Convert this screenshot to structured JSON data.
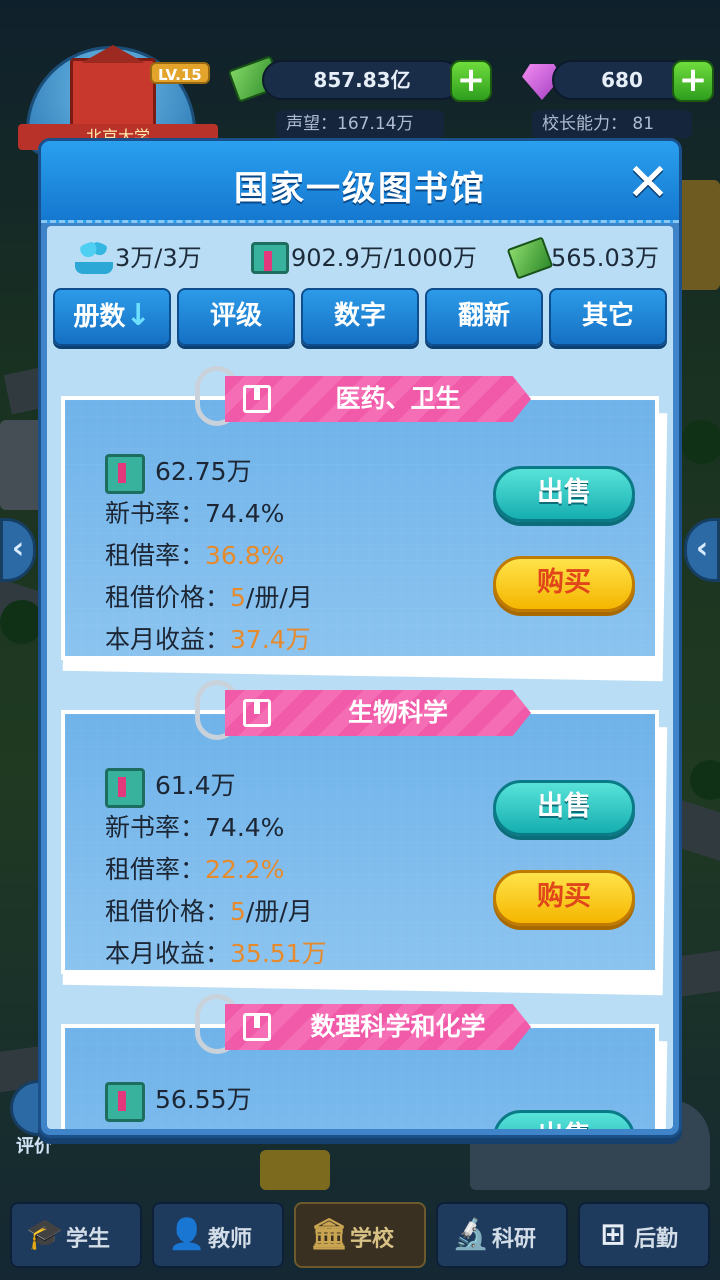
{
  "topbar": {
    "school_name": "北京大学",
    "level": "LV.15",
    "money": "857.83亿",
    "gems": "680",
    "reputation": "声望：167.14万",
    "principal_ability": "校长能力：  81"
  },
  "modal": {
    "title": "国家一级图书馆",
    "stats": {
      "capacity": "3万/3万",
      "books": "902.9万/1000万",
      "funds": "565.03万"
    },
    "tabs": [
      {
        "label": "册数",
        "sort_icon": "↓"
      },
      {
        "label": "评级"
      },
      {
        "label": "数字"
      },
      {
        "label": "翻新"
      },
      {
        "label": "其它"
      }
    ],
    "categories": [
      {
        "name": "医药、卫生",
        "count": "62.75万",
        "new_rate_label": "新书率：",
        "new_rate": "74.4%",
        "borrow_rate_label": "租借率：",
        "borrow_rate": "36.8%",
        "price_label": "租借价格：",
        "price": "5",
        "price_unit": "/册/月",
        "income_label": "本月收益：",
        "income": "37.4万",
        "sell_label": "出售",
        "buy_label": "购买"
      },
      {
        "name": "生物科学",
        "count": "61.4万",
        "new_rate_label": "新书率：",
        "new_rate": "74.4%",
        "borrow_rate_label": "租借率：",
        "borrow_rate": "22.2%",
        "price_label": "租借价格：",
        "price": "5",
        "price_unit": "/册/月",
        "income_label": "本月收益：",
        "income": "35.51万",
        "sell_label": "出售",
        "buy_label": "购买"
      },
      {
        "name": "数理科学和化学",
        "count": "56.55万",
        "sell_label": "出售"
      }
    ]
  },
  "side_badge": "评价",
  "bottom_nav": [
    {
      "label": "学生",
      "icon": "graduation-cap-icon",
      "active": false
    },
    {
      "label": "教师",
      "icon": "teacher-icon",
      "active": false
    },
    {
      "label": "学校",
      "icon": "school-icon",
      "active": true
    },
    {
      "label": "科研",
      "icon": "microscope-icon",
      "active": false
    },
    {
      "label": "后勤",
      "icon": "logistics-icon",
      "active": false
    }
  ],
  "colors": {
    "highlight": "#e68a2e",
    "banner": "#f05aa8",
    "sell_button": "#16aeb0",
    "buy_button": "#f5b600"
  }
}
